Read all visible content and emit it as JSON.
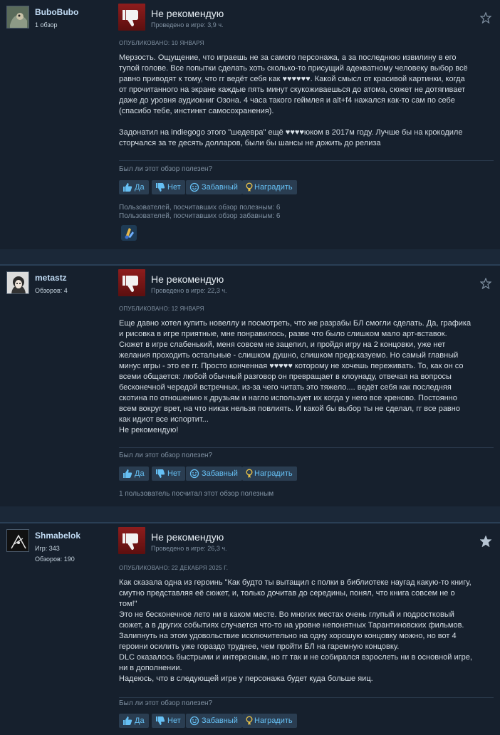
{
  "reviews": [
    {
      "user": {
        "name": "BuboBubo",
        "meta1": "1 обзор",
        "meta2": ""
      },
      "verdict": "Не рекомендую",
      "hours": "Проведено в игре: 3,9 ч.",
      "posted": "ОПУБЛИКОВАНО: 10 ЯНВАРЯ",
      "body": "Мерзость. Ощущение, что играешь не за самого персонажа, а за последнюю извилину в его\nтупой голове. Все попытки сделать хоть сколько-то присущий адекватному человеку выбор всё\nравно приводят к тому, что гг ведёт себя как ♥♥♥♥♥♥. Какой смысл от красивой картинки, когда\nот прочитанного на экране каждые пять минут скукоживаешься до атома, сюжет не дотягивает\nдаже до уровня аудиокниг Озона. 4 часа такого геймлея и alt+f4 нажался как-то сам по себе\n(спасибо тебе, инстинкт самосохранения).\n\nЗадонатил на indiegogo этого \"шедевра\" ещё ♥♥♥♥юком в 2017м году. Лучше бы на крокодиле\nсторчался за те десять долларов, были бы шансы не дожить до релиза",
      "helpful_q": "Был ли этот обзор полезен?",
      "buttons": {
        "yes": "Да",
        "no": "Нет",
        "funny": "Забавный",
        "award": "Наградить"
      },
      "stats": [
        "Пользователей, посчитавших обзор полезным: 6",
        "Пользователей, посчитавших обзор забавным: 6"
      ],
      "awarded": false
    },
    {
      "user": {
        "name": "metastz",
        "meta1": "Обзоров: 4",
        "meta2": ""
      },
      "verdict": "Не рекомендую",
      "hours": "Проведено в игре: 22,3 ч.",
      "posted": "ОПУБЛИКОВАНО: 12 ЯНВАРЯ",
      "body": "Еще давно хотел купить новеллу и посмотреть, что же разрабы БЛ смогли сделать. Да, графика\nи рисовка в игре приятные, мне понравилось, разве что было слишком мало арт-вставок.\nСюжет в игре слабенький, меня совсем не зацепил, и пройдя игру на 2 концовки, уже нет\nжелания проходить остальные - слишком душно, слишком предсказуемо. Но самый главный\nминус игры - это ее гг. Просто конченная ♥♥♥♥♥ которому не хочешь переживать. То, как он со\nвсеми общается: любой обычный разговор он превращает в клоунаду, отвечая на вопросы\nбесконечной чередой встречных, из-за чего читать это тяжело.... ведёт себя как последняя\nскотина по отношению к друзьям и нагло использует их когда у него все хреново. Постоянно\nвсем вокруг врет, на что никак нельзя повлиять. И какой бы выбор ты не сделал, гг все равно\nкак идиот все испортит...\nНе рекомендую!",
      "helpful_q": "Был ли этот обзор полезен?",
      "buttons": {
        "yes": "Да",
        "no": "Нет",
        "funny": "Забавный",
        "award": "Наградить"
      },
      "stats": [
        "1 пользователь посчитал этот обзор полезным"
      ],
      "awarded": false
    },
    {
      "user": {
        "name": "Shmabelok",
        "meta1": "Игр: 343",
        "meta2": "Обзоров: 190"
      },
      "verdict": "Не рекомендую",
      "hours": "Проведено в игре: 26,3 ч.",
      "posted": "ОПУБЛИКОВАНО: 22 ДЕКАБРЯ 2025 Г.",
      "body": "Как сказала одна из героинь \"Как будто ты вытащил с полки в библиотеке наугад какую-то книгу,\nсмутно представляя её сюжет, и, только дочитав до середины, понял, что книга совсем не о\nтом!\"\nЭто не бесконечное лето ни в каком месте. Во многих местах очень глупый и подростковый\nсюжет, а в других событиях случается что-то на уровне непонятных Тарантиновских фильмов.\nЗалипнуть на этом удовольствие исключительно на одну хорошую концовку можно, но вот 4\nгероини осилить уже гораздо труднее, чем пройти БЛ на гаремную концовку.\nDLC оказалось быстрыми и интересным, но гг так и не собирался взрослеть ни в основной игре,\nни в дополнении.\nНадеюсь, что в следующей игре у персонажа будет куда больше яиц.",
      "helpful_q": "Был ли этот обзор полезен?",
      "buttons": {
        "yes": "Да",
        "no": "Нет",
        "funny": "Забавный",
        "award": "Наградить"
      },
      "stats": [],
      "awarded": true
    }
  ]
}
